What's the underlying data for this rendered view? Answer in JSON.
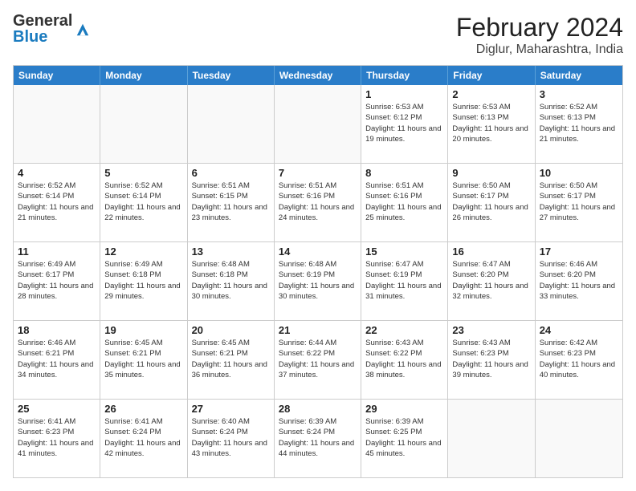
{
  "logo": {
    "general": "General",
    "blue": "Blue"
  },
  "title": "February 2024",
  "subtitle": "Diglur, Maharashtra, India",
  "headers": [
    "Sunday",
    "Monday",
    "Tuesday",
    "Wednesday",
    "Thursday",
    "Friday",
    "Saturday"
  ],
  "weeks": [
    [
      {
        "day": "",
        "info": ""
      },
      {
        "day": "",
        "info": ""
      },
      {
        "day": "",
        "info": ""
      },
      {
        "day": "",
        "info": ""
      },
      {
        "day": "1",
        "info": "Sunrise: 6:53 AM\nSunset: 6:12 PM\nDaylight: 11 hours and 19 minutes."
      },
      {
        "day": "2",
        "info": "Sunrise: 6:53 AM\nSunset: 6:13 PM\nDaylight: 11 hours and 20 minutes."
      },
      {
        "day": "3",
        "info": "Sunrise: 6:52 AM\nSunset: 6:13 PM\nDaylight: 11 hours and 21 minutes."
      }
    ],
    [
      {
        "day": "4",
        "info": "Sunrise: 6:52 AM\nSunset: 6:14 PM\nDaylight: 11 hours and 21 minutes."
      },
      {
        "day": "5",
        "info": "Sunrise: 6:52 AM\nSunset: 6:14 PM\nDaylight: 11 hours and 22 minutes."
      },
      {
        "day": "6",
        "info": "Sunrise: 6:51 AM\nSunset: 6:15 PM\nDaylight: 11 hours and 23 minutes."
      },
      {
        "day": "7",
        "info": "Sunrise: 6:51 AM\nSunset: 6:16 PM\nDaylight: 11 hours and 24 minutes."
      },
      {
        "day": "8",
        "info": "Sunrise: 6:51 AM\nSunset: 6:16 PM\nDaylight: 11 hours and 25 minutes."
      },
      {
        "day": "9",
        "info": "Sunrise: 6:50 AM\nSunset: 6:17 PM\nDaylight: 11 hours and 26 minutes."
      },
      {
        "day": "10",
        "info": "Sunrise: 6:50 AM\nSunset: 6:17 PM\nDaylight: 11 hours and 27 minutes."
      }
    ],
    [
      {
        "day": "11",
        "info": "Sunrise: 6:49 AM\nSunset: 6:17 PM\nDaylight: 11 hours and 28 minutes."
      },
      {
        "day": "12",
        "info": "Sunrise: 6:49 AM\nSunset: 6:18 PM\nDaylight: 11 hours and 29 minutes."
      },
      {
        "day": "13",
        "info": "Sunrise: 6:48 AM\nSunset: 6:18 PM\nDaylight: 11 hours and 30 minutes."
      },
      {
        "day": "14",
        "info": "Sunrise: 6:48 AM\nSunset: 6:19 PM\nDaylight: 11 hours and 30 minutes."
      },
      {
        "day": "15",
        "info": "Sunrise: 6:47 AM\nSunset: 6:19 PM\nDaylight: 11 hours and 31 minutes."
      },
      {
        "day": "16",
        "info": "Sunrise: 6:47 AM\nSunset: 6:20 PM\nDaylight: 11 hours and 32 minutes."
      },
      {
        "day": "17",
        "info": "Sunrise: 6:46 AM\nSunset: 6:20 PM\nDaylight: 11 hours and 33 minutes."
      }
    ],
    [
      {
        "day": "18",
        "info": "Sunrise: 6:46 AM\nSunset: 6:21 PM\nDaylight: 11 hours and 34 minutes."
      },
      {
        "day": "19",
        "info": "Sunrise: 6:45 AM\nSunset: 6:21 PM\nDaylight: 11 hours and 35 minutes."
      },
      {
        "day": "20",
        "info": "Sunrise: 6:45 AM\nSunset: 6:21 PM\nDaylight: 11 hours and 36 minutes."
      },
      {
        "day": "21",
        "info": "Sunrise: 6:44 AM\nSunset: 6:22 PM\nDaylight: 11 hours and 37 minutes."
      },
      {
        "day": "22",
        "info": "Sunrise: 6:43 AM\nSunset: 6:22 PM\nDaylight: 11 hours and 38 minutes."
      },
      {
        "day": "23",
        "info": "Sunrise: 6:43 AM\nSunset: 6:23 PM\nDaylight: 11 hours and 39 minutes."
      },
      {
        "day": "24",
        "info": "Sunrise: 6:42 AM\nSunset: 6:23 PM\nDaylight: 11 hours and 40 minutes."
      }
    ],
    [
      {
        "day": "25",
        "info": "Sunrise: 6:41 AM\nSunset: 6:23 PM\nDaylight: 11 hours and 41 minutes."
      },
      {
        "day": "26",
        "info": "Sunrise: 6:41 AM\nSunset: 6:24 PM\nDaylight: 11 hours and 42 minutes."
      },
      {
        "day": "27",
        "info": "Sunrise: 6:40 AM\nSunset: 6:24 PM\nDaylight: 11 hours and 43 minutes."
      },
      {
        "day": "28",
        "info": "Sunrise: 6:39 AM\nSunset: 6:24 PM\nDaylight: 11 hours and 44 minutes."
      },
      {
        "day": "29",
        "info": "Sunrise: 6:39 AM\nSunset: 6:25 PM\nDaylight: 11 hours and 45 minutes."
      },
      {
        "day": "",
        "info": ""
      },
      {
        "day": "",
        "info": ""
      }
    ]
  ]
}
